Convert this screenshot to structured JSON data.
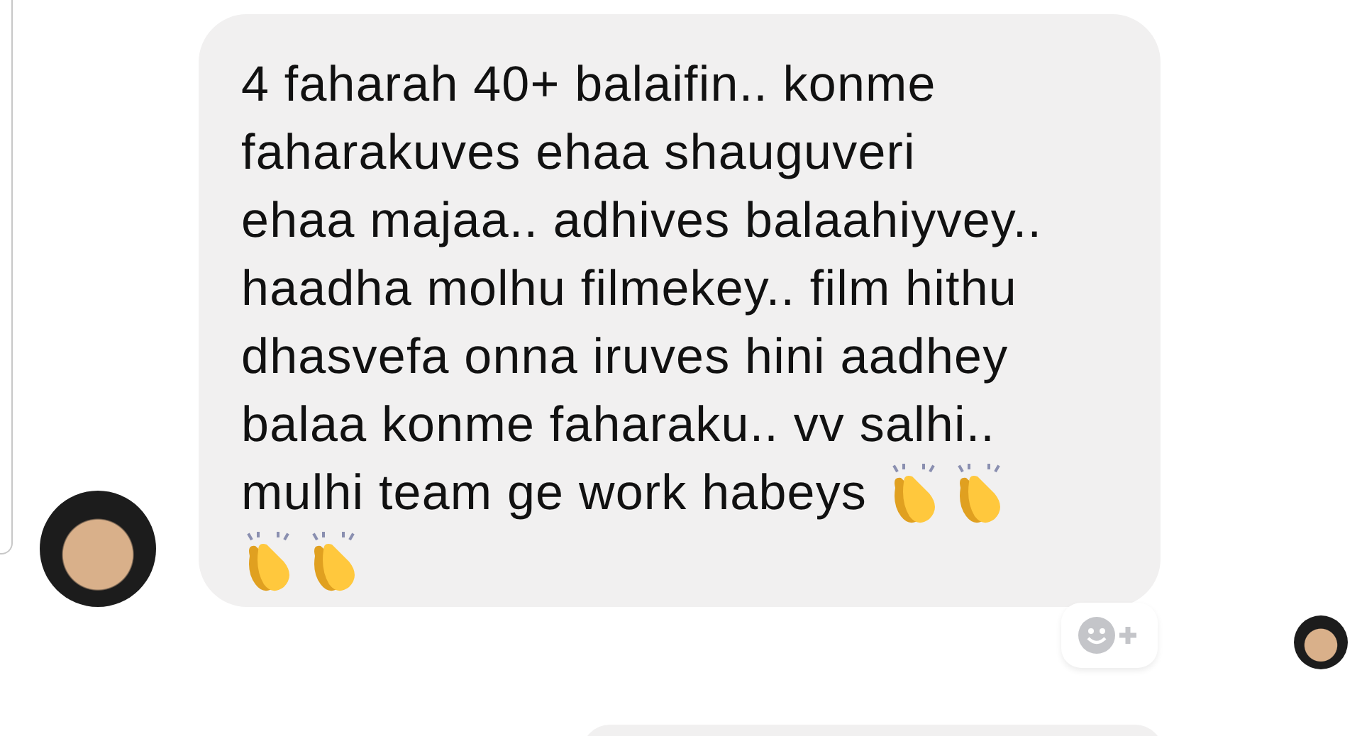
{
  "message": {
    "text": "4 faharah 40+ balaifin.. konme\nfaharakuves ehaa shauguveri\nehaa majaa.. adhives balaahiyvey..\nhaadha molhu filmekey.. film hithu\ndhasvefa onna iruves hini aadhey\nbalaa konme faharaku.. vv salhi..",
    "text_end": "mulhi team ge work habeys",
    "emojis": [
      {
        "kind": "clap"
      },
      {
        "kind": "clap"
      },
      {
        "kind": "clap"
      },
      {
        "kind": "clap"
      }
    ]
  }
}
